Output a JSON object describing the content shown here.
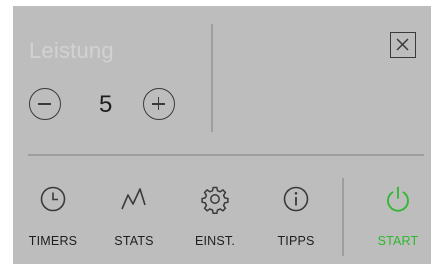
{
  "power_panel": {
    "label": "Leistung",
    "level": "5",
    "decrease_icon": "minus-circle-icon",
    "increase_icon": "plus-circle-icon",
    "close_icon": "close-icon"
  },
  "nav": {
    "items": [
      {
        "label": "TIMERS",
        "icon": "clock-icon"
      },
      {
        "label": "STATS",
        "icon": "chart-line-icon"
      },
      {
        "label": "EINST.",
        "icon": "gear-icon"
      },
      {
        "label": "TIPPS",
        "icon": "info-icon"
      }
    ],
    "start": {
      "label": "START",
      "icon": "power-icon"
    }
  },
  "colors": {
    "panel_background": "#bdbdbd",
    "start_accent": "#2eb82e",
    "label_muted": "#d2d2d2",
    "icon_stroke": "#3a3a3a"
  }
}
